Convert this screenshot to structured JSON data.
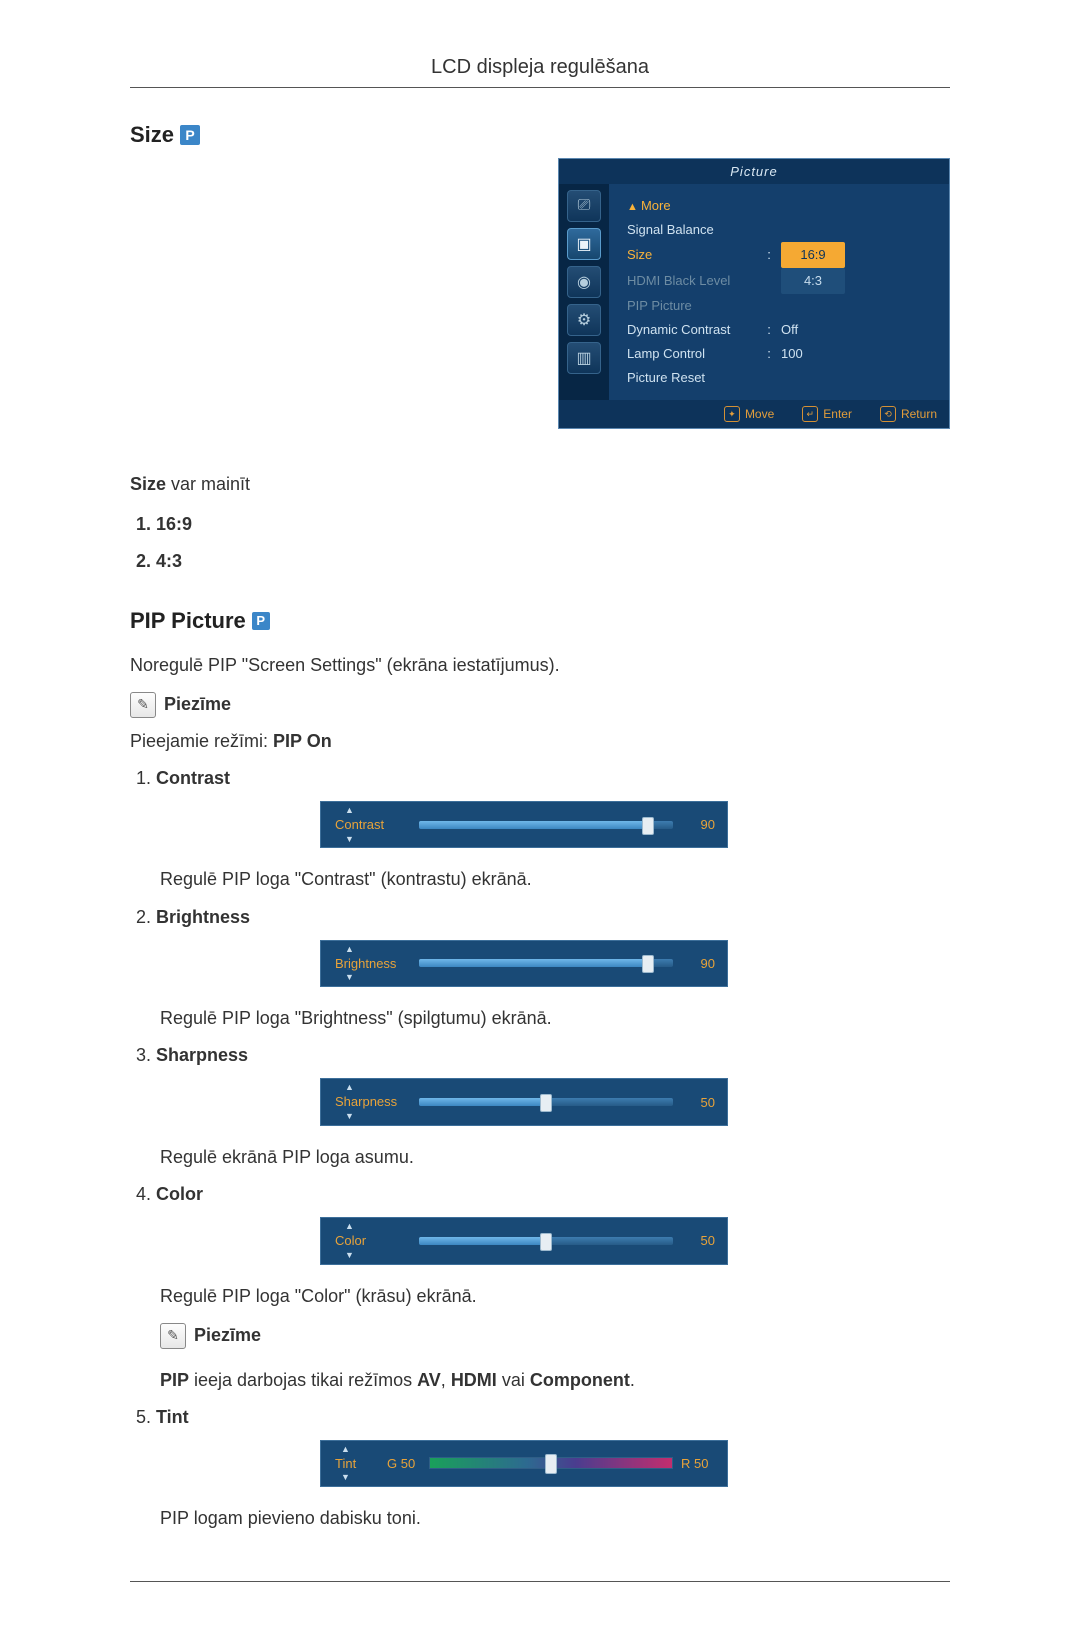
{
  "header": {
    "title": "LCD displeja regulēšana"
  },
  "p_icon": "P",
  "sections": {
    "size": {
      "title": "Size",
      "intro_bold": "Size",
      "intro_rest": " var mainīt",
      "items": [
        "16:9",
        "4:3"
      ]
    },
    "pip": {
      "title": "PIP Picture",
      "intro": "Noregulē PIP \"Screen Settings\" (ekrāna iestatījumus).",
      "note_label": "Piezīme",
      "modes_prefix": "Pieejamie režīmi: ",
      "modes_bold": "PIP On",
      "items": [
        {
          "label": "Contrast",
          "slider": {
            "name": "Contrast",
            "value": 90,
            "max": 100
          },
          "desc": "Regulē PIP loga \"Contrast\" (kontrastu) ekrānā."
        },
        {
          "label": "Brightness",
          "slider": {
            "name": "Brightness",
            "value": 90,
            "max": 100
          },
          "desc": "Regulē PIP loga \"Brightness\" (spilgtumu) ekrānā."
        },
        {
          "label": "Sharpness",
          "slider": {
            "name": "Sharpness",
            "value": 50,
            "max": 100
          },
          "desc": "Regulē ekrānā PIP loga asumu."
        },
        {
          "label": "Color",
          "slider": {
            "name": "Color",
            "value": 50,
            "max": 100
          },
          "desc": "Regulē PIP loga \"Color\" (krāsu) ekrānā.",
          "note": {
            "bold1": "PIP",
            "mid": " ieeja darbojas tikai režīmos ",
            "bold2": "AV",
            "sep1": ", ",
            "bold3": "HDMI",
            "mid2": " vai ",
            "bold4": "Component",
            "end": "."
          }
        },
        {
          "label": "Tint",
          "tint": {
            "name": "Tint",
            "g_label": "G",
            "g_value": 50,
            "r_label": "R",
            "r_value": 50,
            "pos": 50
          },
          "desc": "PIP logam pievieno dabisku toni."
        }
      ]
    }
  },
  "osd_menu": {
    "title": "Picture",
    "rows": [
      {
        "k": "More",
        "type": "more"
      },
      {
        "k": "Signal Balance"
      },
      {
        "k": "Size",
        "val": "16:9",
        "sel": true
      },
      {
        "k": "HDMI Black Level",
        "val": "4:3",
        "ghost": true,
        "dim": true
      },
      {
        "k": "PIP Picture",
        "dim": true
      },
      {
        "k": "Dynamic Contrast",
        "val": "Off",
        "colon": true
      },
      {
        "k": "Lamp Control",
        "val": "100",
        "colon": true
      },
      {
        "k": "Picture Reset"
      }
    ],
    "footer": {
      "move": "Move",
      "enter": "Enter",
      "return": "Return"
    }
  }
}
